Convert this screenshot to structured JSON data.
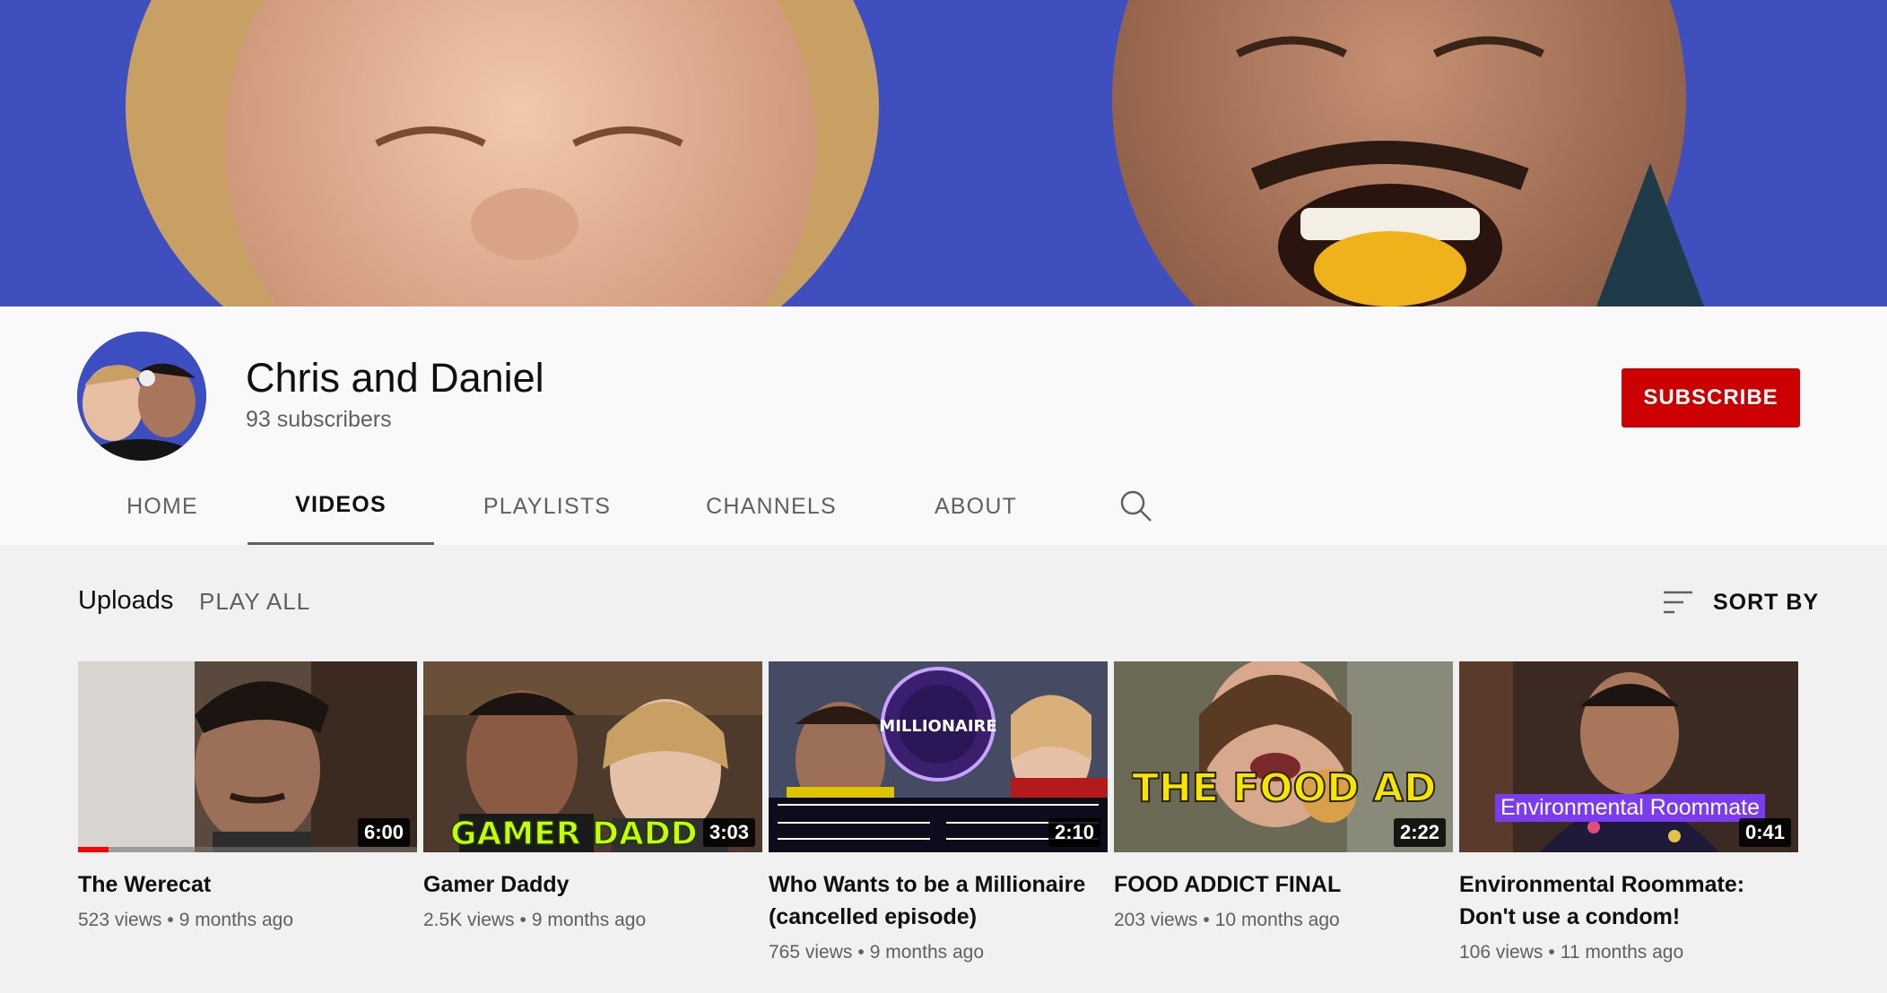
{
  "channel": {
    "name": "Chris and Daniel",
    "subscribers": "93 subscribers",
    "subscribe_label": "SUBSCRIBE"
  },
  "tabs": [
    {
      "label": "HOME",
      "active": false
    },
    {
      "label": "VIDEOS",
      "active": true
    },
    {
      "label": "PLAYLISTS",
      "active": false
    },
    {
      "label": "CHANNELS",
      "active": false
    },
    {
      "label": "ABOUT",
      "active": false
    }
  ],
  "section": {
    "title": "Uploads",
    "play_all": "PLAY ALL",
    "sort_by": "SORT BY"
  },
  "videos": [
    {
      "title": "The Werecat",
      "views": "523 views",
      "age": "9 months ago",
      "duration": "6:00",
      "watched_fraction": 0.09
    },
    {
      "title": "Gamer Daddy",
      "views": "2.5K views",
      "age": "9 months ago",
      "duration": "3:03",
      "thumb_text": "GAMER DADD"
    },
    {
      "title": "Who Wants to be a Millionaire (cancelled episode)",
      "views": "765 views",
      "age": "9 months ago",
      "duration": "2:10",
      "thumb_text": "MILLIONAIRE"
    },
    {
      "title": "FOOD ADDICT FINAL",
      "views": "203 views",
      "age": "10 months ago",
      "duration": "2:22",
      "thumb_text": "THE FOOD ADDICT"
    },
    {
      "title": "Environmental Roommate: Don't use a condom!",
      "views": "106 views",
      "age": "11 months ago",
      "duration": "0:41",
      "thumb_text": "Environmental Roommate"
    }
  ],
  "colors": {
    "subscribe": "#cc0000",
    "banner": "#3f4fbd",
    "progress": "#ff0000"
  }
}
